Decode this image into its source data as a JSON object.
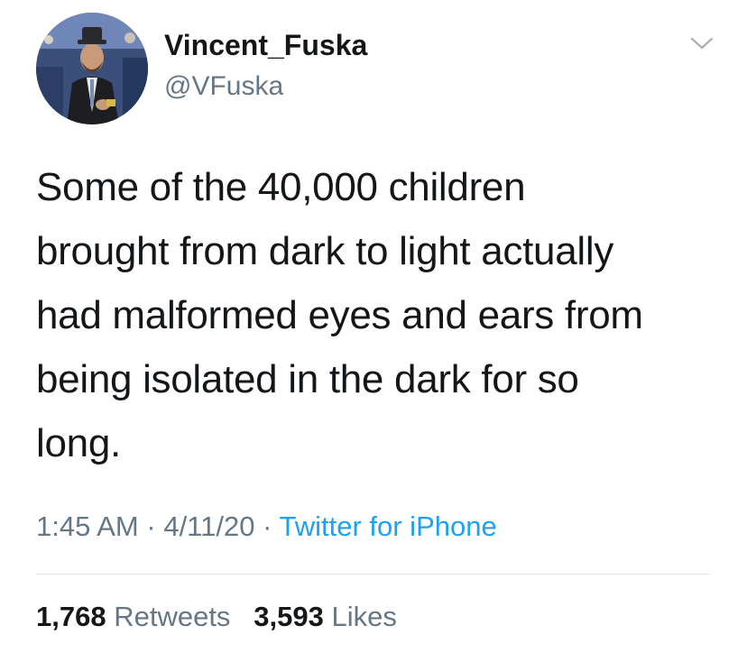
{
  "tweet": {
    "author": {
      "display_name": "Vincent_Fuska",
      "handle": "@VFuska"
    },
    "text": "Some of the 40,000 children\nbrought from dark to light actually\nhad malformed eyes and ears from\nbeing isolated in the dark for so\nlong.",
    "time": "1:45 AM",
    "separator": "·",
    "date": "4/11/20",
    "source": "Twitter for iPhone",
    "retweets": {
      "count": "1,768",
      "label": "Retweets"
    },
    "likes": {
      "count": "3,593",
      "label": "Likes"
    }
  },
  "colors": {
    "text_primary": "#14171a",
    "text_secondary": "#657786",
    "link": "#1da1f2",
    "divider": "#e1e8ed"
  },
  "icons": {
    "menu": "chevron-down-icon"
  }
}
